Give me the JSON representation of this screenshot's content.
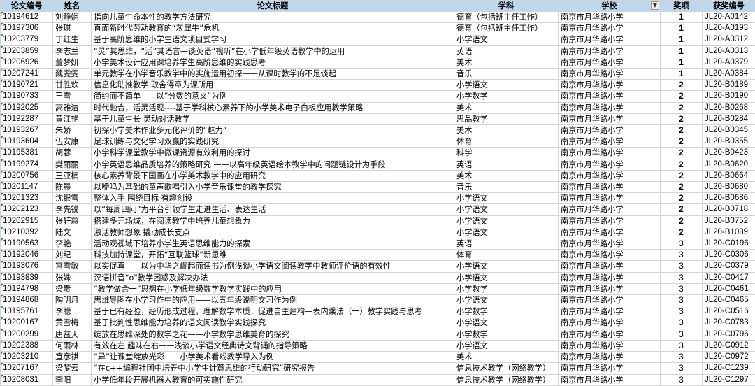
{
  "headers": {
    "id": "论文编号",
    "name": "姓名",
    "title": "论文标题",
    "subject": "学科",
    "school": "学校",
    "award": "奖项",
    "code": "获奖编号"
  },
  "icons": {
    "filter": "filter-icon"
  },
  "rows": [
    {
      "id": "10194612",
      "name": "刘静娴",
      "title": "指向儿童生命本性的教学方法研究",
      "subject": "德育（包括班主任工作）",
      "school": "南京市月华路小学",
      "award": "1",
      "code": "JL20-A0142"
    },
    {
      "id": "10197306",
      "name": "张琪",
      "title": "直面新时代劳动教育的“灰犀牛”危机",
      "subject": "德育（包括班主任工作）",
      "school": "南京市月华路小学",
      "award": "1",
      "code": "JL20-A0193"
    },
    {
      "id": "10203779",
      "name": "丁红生",
      "title": "基于高阶思维的小学生语文项目式学习",
      "subject": "小学语文",
      "school": "南京市月华路小学",
      "award": "1",
      "code": "JL20-A0312"
    },
    {
      "id": "10203859",
      "name": "李志兰",
      "title": "“灵”其思维，“活”其语言—谈英语“视听”在小学低年级英语教学中的运用",
      "subject": "英语",
      "school": "南京市月华路小学",
      "award": "1",
      "code": "JL20-A0313"
    },
    {
      "id": "10206926",
      "name": "董梦妍",
      "title": "小学美术设计应用课培养学生高阶思维的实践思考",
      "subject": "美术",
      "school": "南京市月华路小学",
      "award": "1",
      "code": "JL20-A0379"
    },
    {
      "id": "10207241",
      "name": "魏雯雯",
      "title": "单元教学在小学音乐教学中的实施运用初探——从课时教学的不足谈起",
      "subject": "音乐",
      "school": "南京市月华路小学",
      "award": "1",
      "code": "JL20-A0384"
    },
    {
      "id": "10190721",
      "name": "甘胜欢",
      "title": "信息化助推教学 取舍得章为课所用",
      "subject": "小学语文",
      "school": "南京市月华路小学",
      "award": "2",
      "code": "JL20-B0189"
    },
    {
      "id": "10190733",
      "name": "王雪",
      "title": "简约而不简单——以“分数的意义”为例",
      "subject": "小学数学",
      "school": "南京市月华路小学",
      "award": "2",
      "code": "JL20-B0190"
    },
    {
      "id": "10192025",
      "name": "高雅洁",
      "title": "时代融合，活灵活现----基于学科核心素养下的小学美术电子白板应用教学策略",
      "subject": "美术",
      "school": "南京市月华路小学",
      "award": "2",
      "code": "JL20-B0268"
    },
    {
      "id": "10192287",
      "name": "黄江艳",
      "title": "基于儿童生长 灵动对话教学",
      "subject": "思品教学",
      "school": "南京市月华路小学",
      "award": "2",
      "code": "JL20-B0284"
    },
    {
      "id": "10193267",
      "name": "朱娇",
      "title": "初探小学美术作业多元化评价的“魅力”",
      "subject": "美术",
      "school": "南京市月华路小学",
      "award": "2",
      "code": "JL20-B0345"
    },
    {
      "id": "10193604",
      "name": "伍安康",
      "title": "足球训练与文化学习双赢的实践研究",
      "subject": "体育",
      "school": "南京市月华路小学",
      "award": "2",
      "code": "JL20-B0355"
    },
    {
      "id": "10195381",
      "name": "胡蓉",
      "title": "小学科学课堂教学中微课资源有效利用的探讨",
      "subject": "科学",
      "school": "南京市月华路小学",
      "award": "2",
      "code": "JL20-B0423"
    },
    {
      "id": "10199274",
      "name": "樊丽丽",
      "title": "小学英语思维品质培养的策略研究 ——以高年级英语绘本教学中的问题链设计为手段",
      "subject": "英语",
      "school": "南京市月华路小学",
      "award": "2",
      "code": "JL20-B0620"
    },
    {
      "id": "10200756",
      "name": "王亚楠",
      "title": "核心素养背景下国画在小学美术教学中的应用研究",
      "subject": "美术",
      "school": "南京市月华路小学",
      "award": "2",
      "code": "JL20-B0664"
    },
    {
      "id": "10201147",
      "name": "陈晨",
      "title": "以咿鸣为基础的童声歌唱引入小学音乐课堂的教学探究",
      "subject": "音乐",
      "school": "南京市月华路小学",
      "award": "2",
      "code": "JL20-B0680"
    },
    {
      "id": "10201323",
      "name": "沈银雪",
      "title": "整体入手 围绕目标 有趣创设",
      "subject": "小学语文",
      "school": "南京市月华路小学",
      "award": "2",
      "code": "JL20-B0686"
    },
    {
      "id": "10202123",
      "name": "李先锐",
      "title": "以“每周四问”为平台引领学生走进生活、表达生活",
      "subject": "小学语文",
      "school": "南京市月华路小学",
      "award": "2",
      "code": "JL20-B0718"
    },
    {
      "id": "10202915",
      "name": "张轩慈",
      "title": "搭建多元场域，在阅读教学中培养儿童想象力",
      "subject": "小学语文",
      "school": "南京市月华路小学",
      "award": "2",
      "code": "JL20-B0752"
    },
    {
      "id": "10210392",
      "name": "陆文",
      "title": "激活教师想象 撬动成长支点",
      "subject": "小学语文",
      "school": "南京市月华路小学",
      "award": "2",
      "code": "JL20-B1089"
    },
    {
      "id": "10190563",
      "name": "李艳",
      "title": "活动观视域下培养小学生英语思维能力的探索",
      "subject": "英语",
      "school": "南京市月华路小学",
      "award": "3",
      "code": "JL20-C0196"
    },
    {
      "id": "10192046",
      "name": "刘纪",
      "title": "科技加持课堂，开拓“互联篮球”新思维",
      "subject": "体育",
      "school": "南京市月华路小学",
      "award": "3",
      "code": "JL20-C0306"
    },
    {
      "id": "10193076",
      "name": "宫雪敏",
      "title": "以实促真——以为中华之崛起而读书为例浅谈小学语文阅读教学中教师评价语的有效性",
      "subject": "小学语文",
      "school": "南京市月华路小学",
      "award": "3",
      "code": "JL20-C0379"
    },
    {
      "id": "10193839",
      "name": "张姝",
      "title": "汉语拼音“o”教学困惑及解决办法",
      "subject": "小学语文",
      "school": "南京市月华路小学",
      "award": "3",
      "code": "JL20-C0417"
    },
    {
      "id": "10194798",
      "name": "梁贵",
      "title": "“教学做合一”思想在小学低年级数学教学实践中的应用",
      "subject": "小学数学",
      "school": "南京市月华路小学",
      "award": "3",
      "code": "JL20-C0461"
    },
    {
      "id": "10194868",
      "name": "陶明月",
      "title": "思维导图在小学习作中的应用——以五年级说明文习作为例",
      "subject": "小学语文",
      "school": "南京市月华路小学",
      "award": "3",
      "code": "JL20-C0465"
    },
    {
      "id": "10195761",
      "name": "李聪",
      "title": "基于已有经验，经历形成过程，理解数学本质，促进自主建构—表内乘法（一）教学实践与思考",
      "subject": "小学数学",
      "school": "南京市月华路小学",
      "award": "3",
      "code": "JL20-C0516"
    },
    {
      "id": "10200167",
      "name": "黄雪梅",
      "title": "基于批判性思维能力培养的语文阅读教学实践探究",
      "subject": "小学语文",
      "school": "南京市月华路小学",
      "award": "3",
      "code": "JL20-C0783"
    },
    {
      "id": "10200299",
      "name": "唐益天",
      "title": "绽放在思维深处的数学之花——小学数学思维美育的探究",
      "subject": "小学数学",
      "school": "南京市月华路小学",
      "award": "3",
      "code": "JL20-C0796"
    },
    {
      "id": "10202388",
      "name": "何雨林",
      "title": "有效在左 趣味在右——浅谈小学语文经典诗文背诵的指导策略",
      "subject": "小学语文",
      "school": "南京市月华路小学",
      "award": "3",
      "code": "JL20-C0912"
    },
    {
      "id": "10203210",
      "name": "笪彦祺",
      "title": "“异”让课堂绽放光彩——小学美术看戏教学导入为例",
      "subject": "美术",
      "school": "南京市月华路小学",
      "award": "3",
      "code": "JL20-C0972"
    },
    {
      "id": "10207167",
      "name": "梁梦云",
      "title": "“在c++编程社团中培养中小学生计算思维的行动研究”研究报告",
      "subject": "信息技术教学（网络教学）",
      "school": "南京市月华路小学",
      "award": "3",
      "code": "JL20-C1239"
    },
    {
      "id": "10208031",
      "name": "李阳",
      "title": "小学低年段开展机器人教育的可实施性研究",
      "subject": "信息技术教学（网络教学）",
      "school": "南京市月华路小学",
      "award": "3",
      "code": "JL20-C1297"
    }
  ]
}
